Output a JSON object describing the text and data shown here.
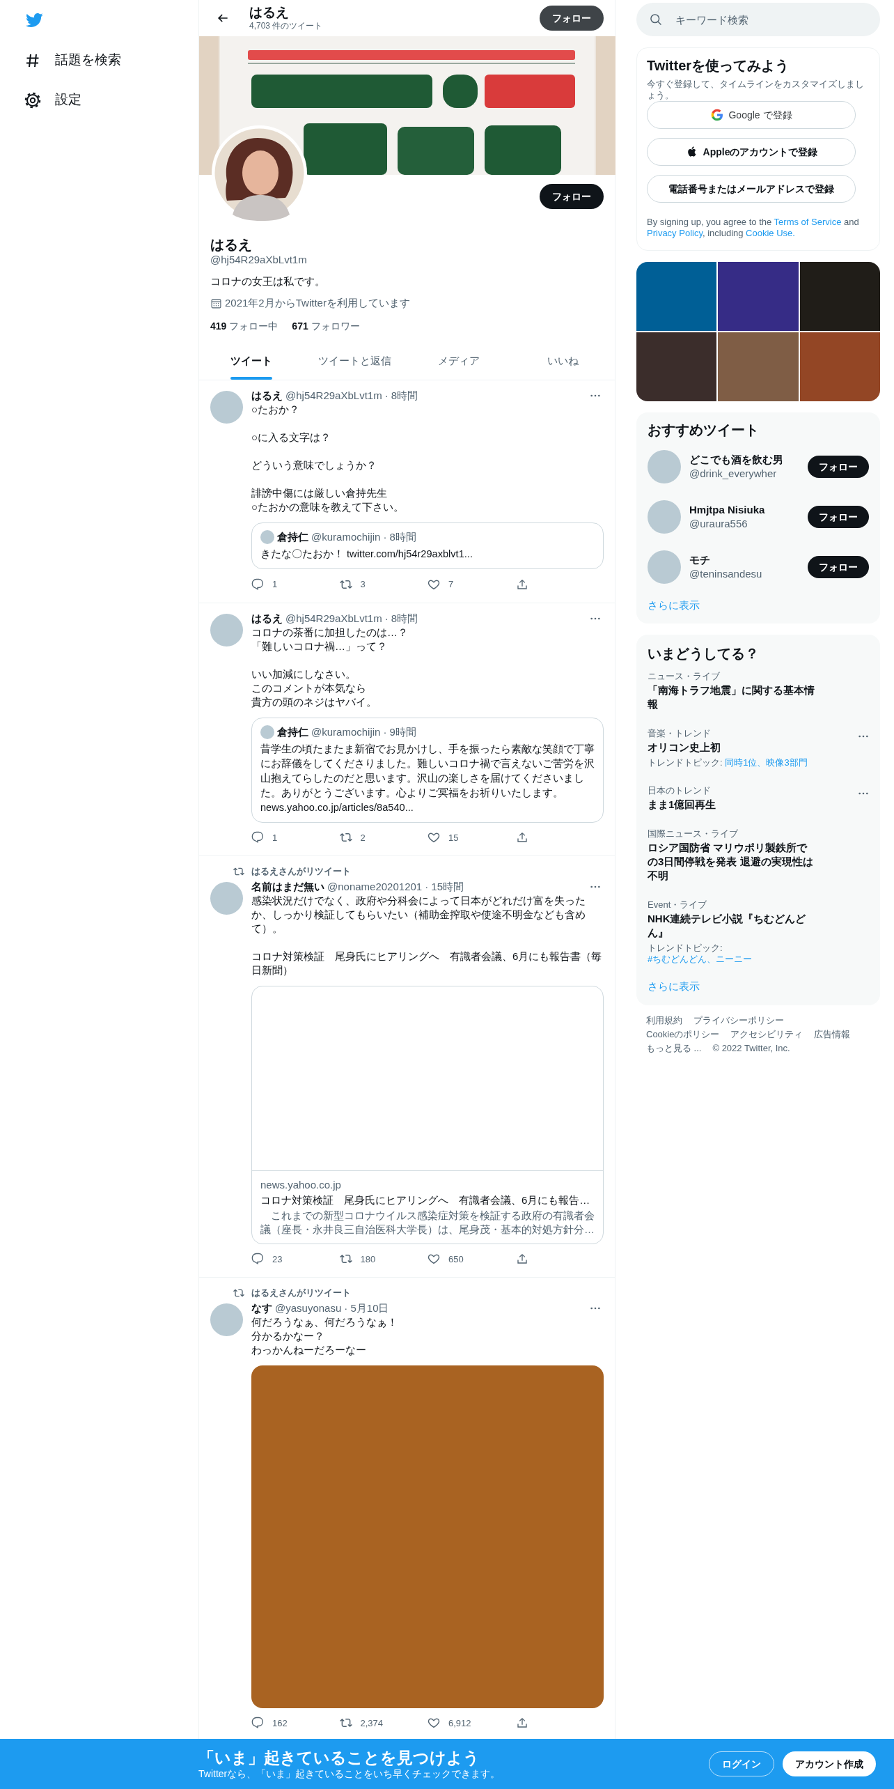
{
  "sidebar": {
    "items": [
      {
        "kind": "explore",
        "label": "話題を検索"
      },
      {
        "kind": "settings",
        "label": "設定"
      }
    ]
  },
  "header": {
    "name": "はるえ",
    "tweet_count": "4,703 件のツイート",
    "follow_button": "フォロー"
  },
  "profile": {
    "follow_button": "フォロー",
    "name": "はるえ",
    "handle": "@hj54R29aXbLvt1m",
    "bio": "コロナの女王は私です。",
    "joined": "2021年2月からTwitterを利用しています",
    "following_count": "419",
    "following_label": "フォロー中",
    "followers_count": "671",
    "followers_label": "フォロワー"
  },
  "tabs": [
    {
      "label": "ツイート",
      "selected": true
    },
    {
      "label": "ツイートと返信",
      "selected": false
    },
    {
      "label": "メディア",
      "selected": false
    },
    {
      "label": "いいね",
      "selected": false
    }
  ],
  "tweets": [
    {
      "name": "はるえ",
      "handle": "@hj54R29aXbLvt1m",
      "time": "· 8時間",
      "paragraphs": [
        [
          "○たおか？"
        ],
        [
          "○に入る文字は？"
        ],
        [
          "どういう意味でしょうか？"
        ],
        [
          "誹謗中傷には厳しい倉持先生",
          "○たおかの意味を教えて下さい。"
        ]
      ],
      "quote": {
        "name": "倉持仁",
        "handle": "@kuramochijin",
        "time": "· 8時間",
        "lines": [
          "きたな〇たおか！ twitter.com/hj54r29axblvt1..."
        ]
      },
      "replies": "1",
      "retweets": "3",
      "likes": "7"
    },
    {
      "name": "はるえ",
      "handle": "@hj54R29aXbLvt1m",
      "time": "· 8時間",
      "paragraphs": [
        [
          "コロナの茶番に加担したのは…？",
          "「難しいコロナ禍…」って？"
        ],
        [
          "いい加減にしなさい。",
          "このコメントが本気なら",
          "貴方の頭のネジはヤバイ。"
        ]
      ],
      "quote": {
        "name": "倉持仁",
        "handle": "@kuramochijin",
        "time": "· 9時間",
        "lines": [
          "昔学生の頃たまたま新宿でお見かけし、手を振ったら素敵な笑顔で丁寧にお辞儀をしてくださりました。難しいコロナ禍で言えないご苦労を沢山抱えてらしたのだと思います。沢山の楽しさを届けてくださいました。ありがとうございます。心よりご冥福をお祈りいたします。",
          "news.yahoo.co.jp/articles/8a540..."
        ]
      },
      "replies": "1",
      "retweets": "2",
      "likes": "15"
    },
    {
      "retweeted_by": "はるえさんがリツイート",
      "name": "名前はまだ無い",
      "handle": "@noname20201201",
      "time": "· 15時間",
      "paragraphs": [
        [
          "感染状況だけでなく、政府や分科会によって日本がどれだけ富を失ったか、しっかり検証してもらいたい（補助金搾取や使途不明金なども含めて）。"
        ],
        [
          "コロナ対策検証　尾身氏にヒアリングへ　有識者会議、6月にも報告書（毎日新聞）"
        ]
      ],
      "link_card": {
        "domain": "news.yahoo.co.jp",
        "title": "コロナ対策検証　尾身氏にヒアリングへ　有識者会議、6月にも報告…",
        "description": "　これまでの新型コロナウイルス感染症対策を検証する政府の有識者会議（座長・永井良三自治医科大学長）は、尾身茂・基本的対処方針分…"
      },
      "replies": "23",
      "retweets": "180",
      "likes": "650"
    },
    {
      "retweeted_by": "はるえさんがリツイート",
      "name": "なす",
      "handle": "@yasuyonasu",
      "time": "· 5月10日",
      "paragraphs": [
        [
          "何だろうなぁ、何だろうなぁ！",
          "分かるかなー？",
          "わっかんねーだろーなー"
        ]
      ],
      "image": {
        "color": "#a96322"
      },
      "replies": "162",
      "retweets": "2,374",
      "likes": "6,912"
    }
  ],
  "search": {
    "placeholder": "キーワード検索"
  },
  "signup": {
    "title": "Twitterを使ってみよう",
    "subtitle": "今すぐ登録して、タイムラインをカスタマイズしましょう。",
    "buttons": [
      {
        "kind": "google",
        "label": "Google で登録"
      },
      {
        "kind": "apple",
        "label": "Appleのアカウントで登録"
      },
      {
        "kind": "phone",
        "label": "電話番号またはメールアドレスで登録"
      }
    ],
    "legal": [
      {
        "text": "By signing up, you agree to the ",
        "link": false
      },
      {
        "text": "Terms of Service",
        "link": true
      },
      {
        "text": " and ",
        "link": false
      },
      {
        "text": "Privacy Policy",
        "link": true
      },
      {
        "text": ", including ",
        "link": false
      },
      {
        "text": "Cookie Use.",
        "link": true
      }
    ]
  },
  "media": [
    {
      "color": "#005f96"
    },
    {
      "color": "#362c86"
    },
    {
      "color": "#201d18"
    },
    {
      "color": "#3b2d2b"
    },
    {
      "color": "#7f5d45"
    },
    {
      "color": "#934625"
    }
  ],
  "recommended": {
    "title": "おすすめツイート",
    "users": [
      {
        "name": "どこでも酒を飲む男",
        "handle": "@drink_everywher",
        "button": "フォロー"
      },
      {
        "name": "Hmjtpa Nisiuka",
        "handle": "@uraura556",
        "button": "フォロー"
      },
      {
        "name": "モチ",
        "handle": "@teninsandesu",
        "button": "フォロー"
      }
    ],
    "more": "さらに表示"
  },
  "trends": {
    "title": "いまどうしてる？",
    "items": [
      {
        "category": "ニュース・ライブ",
        "title": "「南海トラフ地震」に関する基本情報",
        "menu": false
      },
      {
        "category": "音楽・トレンド",
        "title": "オリコン史上初",
        "topic_label": "トレンドトピック: ",
        "topic": "同時1位、映像3部門",
        "menu": true
      },
      {
        "category": "日本のトレンド",
        "title": "まま1億回再生",
        "menu": true
      },
      {
        "category": "国際ニュース・ライブ",
        "title": "ロシア国防省 マリウポリ製鉄所での3日間停戦を発表 退避の実現性は不明",
        "menu": false
      },
      {
        "category": "Event・ライブ",
        "title": "NHK連続テレビ小説『ちむどんどん』",
        "topic_label": "トレンドトピック: ",
        "topic": "#ちむどんどん、ニーニー",
        "menu": false
      }
    ],
    "more": "さらに表示"
  },
  "footer": [
    [
      "利用規約",
      "プライバシーポリシー"
    ],
    [
      "Cookieのポリシー",
      "アクセシビリティ",
      "広告情報"
    ],
    [
      "もっと見る ...",
      "© 2022 Twitter, Inc."
    ]
  ],
  "bottom_bar": {
    "title": "「いま」起きていることを見つけよう",
    "subtitle": "Twitterなら、「いま」起きていることをいち早くチェックできます。",
    "login": "ログイン",
    "signup": "アカウント作成"
  }
}
